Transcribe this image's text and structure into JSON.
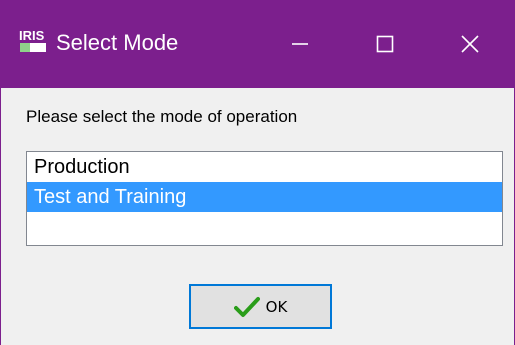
{
  "window": {
    "title": "Select Mode",
    "app_icon": "iris-app-icon",
    "app_icon_text": "IRIS",
    "controls": {
      "minimize_icon": "minimize-icon",
      "maximize_icon": "maximize-icon",
      "close_icon": "close-icon"
    }
  },
  "dialog": {
    "prompt": "Please select the mode of operation",
    "options": [
      {
        "label": "Production",
        "selected": false
      },
      {
        "label": "Test and Training",
        "selected": true
      }
    ],
    "ok_button": {
      "label": "OK",
      "icon": "checkmark-icon"
    }
  },
  "colors": {
    "titlebar": "#7c1f8d",
    "selection": "#3399ff",
    "button_focus_border": "#0078d7",
    "checkmark": "#2a9d1a"
  }
}
